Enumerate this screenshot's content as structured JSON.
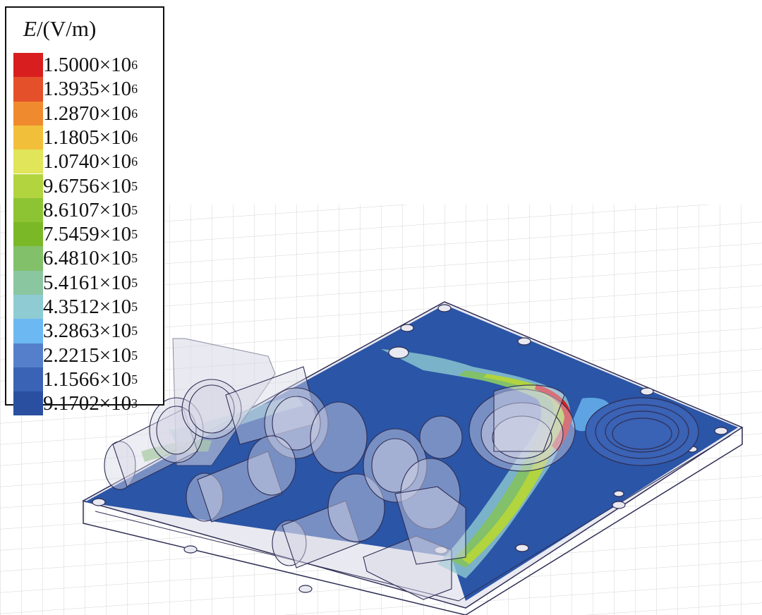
{
  "legend": {
    "title_var": "E",
    "title_unit": "/(V/m)",
    "entries": [
      {
        "mantissa": "1.5000×10",
        "exp": "6",
        "color": "#d81e1e"
      },
      {
        "mantissa": "1.3935×10",
        "exp": "6",
        "color": "#e4502a"
      },
      {
        "mantissa": "1.2870×10",
        "exp": "6",
        "color": "#f08a2f"
      },
      {
        "mantissa": "1.1805×10",
        "exp": "6",
        "color": "#f2bf3a"
      },
      {
        "mantissa": "1.0740×10",
        "exp": "6",
        "color": "#e0e55a"
      },
      {
        "mantissa": "9.6756×10",
        "exp": "5",
        "color": "#b2d43e"
      },
      {
        "mantissa": "8.6107×10",
        "exp": "5",
        "color": "#8cc434"
      },
      {
        "mantissa": "7.5459×10",
        "exp": "5",
        "color": "#7ab828"
      },
      {
        "mantissa": "6.4810×10",
        "exp": "5",
        "color": "#82c06a"
      },
      {
        "mantissa": "5.4161×10",
        "exp": "5",
        "color": "#8ac6a0"
      },
      {
        "mantissa": "4.3512×10",
        "exp": "5",
        "color": "#8ecbd2"
      },
      {
        "mantissa": "3.2863×10",
        "exp": "5",
        "color": "#6cb8f2"
      },
      {
        "mantissa": "2.2215×10",
        "exp": "5",
        "color": "#557fcb"
      },
      {
        "mantissa": "1.1566×10",
        "exp": "5",
        "color": "#3a62b5"
      },
      {
        "mantissa": "9.1702×10",
        "exp": "3",
        "color": "#2a4fa0"
      }
    ]
  },
  "colors": {
    "plate": "#2b55a6",
    "grid": "#c9c9c9",
    "outline": "#2e2e55",
    "ghost": "#d8d8e6"
  }
}
